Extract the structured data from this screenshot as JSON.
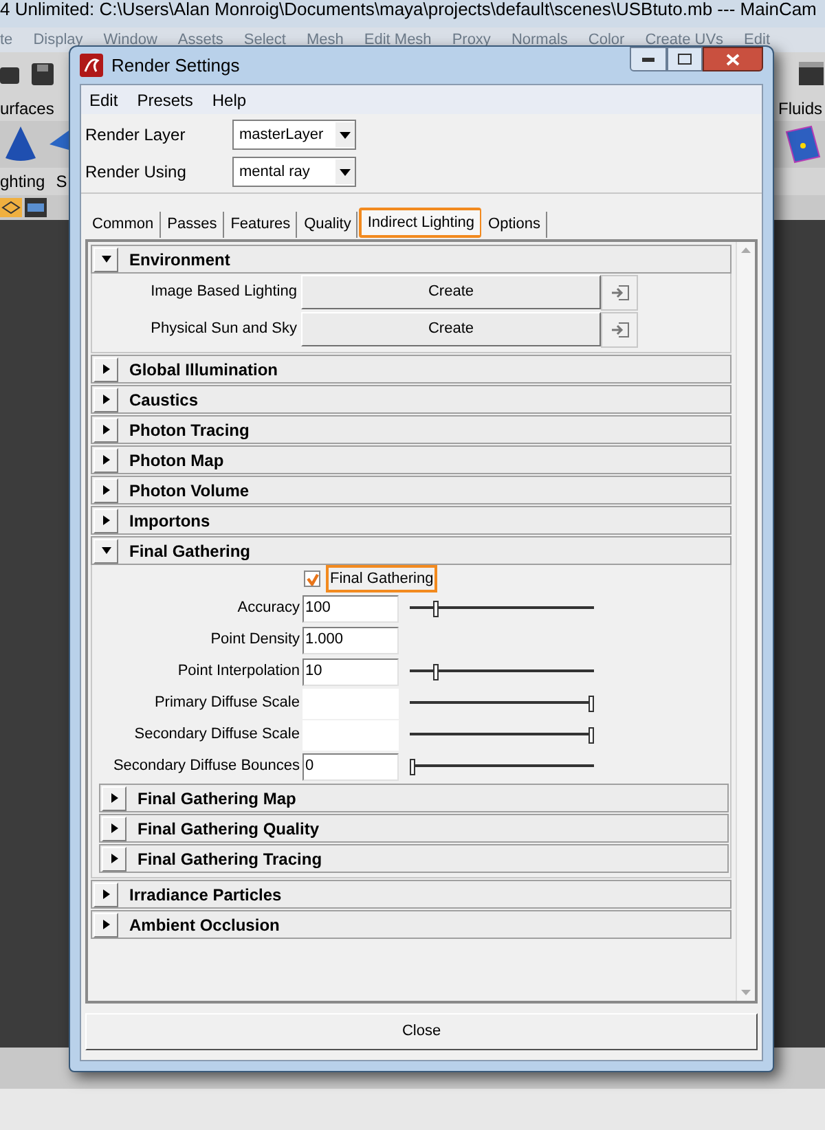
{
  "app": {
    "title": "4 Unlimited: C:\\Users\\Alan Monroig\\Documents\\maya\\projects\\default\\scenes\\USBtuto.mb   ---   MainCam",
    "menu": [
      "te",
      "Display",
      "Window",
      "Assets",
      "Select",
      "Mesh",
      "Edit Mesh",
      "Proxy",
      "Normals",
      "Color",
      "Create UVs",
      "Edit"
    ],
    "shelf_tabs": [
      "urfaces",
      "Fluids"
    ],
    "panel_menu": [
      "ghting",
      "S"
    ]
  },
  "dialog": {
    "title": "Render Settings",
    "menu": [
      "Edit",
      "Presets",
      "Help"
    ],
    "options": [
      {
        "label": "Render Layer",
        "value": "masterLayer"
      },
      {
        "label": "Render Using",
        "value": "mental ray"
      }
    ],
    "tabs": [
      {
        "label": "Common",
        "selected": false,
        "highlighted": false
      },
      {
        "label": "Passes",
        "selected": false,
        "highlighted": false
      },
      {
        "label": "Features",
        "selected": false,
        "highlighted": false
      },
      {
        "label": "Quality",
        "selected": false,
        "highlighted": false
      },
      {
        "label": "Indirect Lighting",
        "selected": true,
        "highlighted": true
      },
      {
        "label": "Options",
        "selected": false,
        "highlighted": false
      }
    ],
    "sections": [
      {
        "title": "Environment",
        "expanded": true,
        "rows": [
          {
            "kind": "create",
            "label": "Image Based Lighting",
            "button": "Create"
          },
          {
            "kind": "create",
            "label": "Physical Sun and Sky",
            "button": "Create"
          }
        ]
      },
      {
        "title": "Global Illumination",
        "expanded": false
      },
      {
        "title": "Caustics",
        "expanded": false
      },
      {
        "title": "Photon Tracing",
        "expanded": false
      },
      {
        "title": "Photon Map",
        "expanded": false
      },
      {
        "title": "Photon Volume",
        "expanded": false
      },
      {
        "title": "Importons",
        "expanded": false
      },
      {
        "title": "Final Gathering",
        "expanded": true,
        "rows": [
          {
            "kind": "checkbox",
            "label": "Final Gathering",
            "checked": true,
            "highlighted": true
          },
          {
            "kind": "field",
            "label": "Accuracy",
            "value": "100",
            "level": 0.13
          },
          {
            "kind": "field",
            "label": "Point Density",
            "value": "1.000"
          },
          {
            "kind": "field",
            "label": "Point Interpolation",
            "value": "10",
            "level": 0.13
          },
          {
            "kind": "field",
            "label": "Primary Diffuse Scale",
            "level": 1
          },
          {
            "kind": "field",
            "label": "Secondary Diffuse Scale",
            "level": 1
          },
          {
            "kind": "field",
            "label": "Secondary Diffuse Bounces",
            "value": "0",
            "level": 0
          }
        ],
        "children": [
          {
            "title": "Final Gathering Map",
            "expanded": false
          },
          {
            "title": "Final Gathering Quality",
            "expanded": false
          },
          {
            "title": "Final Gathering Tracing",
            "expanded": false
          }
        ]
      },
      {
        "title": "Irradiance Particles",
        "expanded": false
      },
      {
        "title": "Ambient Occlusion",
        "expanded": false
      }
    ],
    "close_button": "Close"
  }
}
